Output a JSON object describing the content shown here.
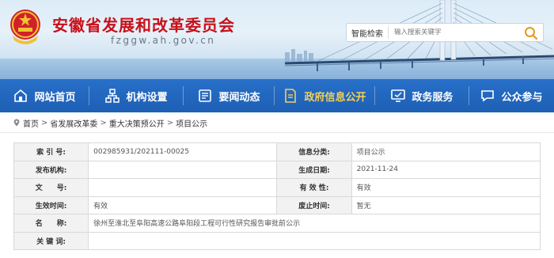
{
  "header": {
    "site_title": "安徽省发展和改革委员会",
    "site_url": "fzggw.ah.gov.cn"
  },
  "search": {
    "scope": "智能检索",
    "placeholder": "输入搜索关键字"
  },
  "nav": {
    "items": [
      {
        "label": "网站首页",
        "icon": "home-icon"
      },
      {
        "label": "机构设置",
        "icon": "org-icon"
      },
      {
        "label": "要闻动态",
        "icon": "news-icon"
      },
      {
        "label": "政府信息公开",
        "icon": "document-icon",
        "active": true
      },
      {
        "label": "政务服务",
        "icon": "monitor-icon"
      },
      {
        "label": "公众参与",
        "icon": "chat-icon"
      }
    ],
    "active_color": "#f1d05a",
    "bar_color": "#1d5fb5"
  },
  "breadcrumb": [
    "首页",
    "省发展改革委",
    "重大决策预公开",
    "项目公示"
  ],
  "info": {
    "index_label": "索 引 号:",
    "index_value": "002985931/202111-00025",
    "category_label": "信息分类:",
    "category_value": "项目公示",
    "publisher_label": "发布机构:",
    "publisher_value": "",
    "date_label": "生成日期:",
    "date_value": "2021-11-24",
    "docno_label": "文　　号:",
    "docno_value": "",
    "validity_label": "有 效 性:",
    "validity_value": "有效",
    "effective_label": "生效时间:",
    "effective_value": "有效",
    "expiry_label": "废止时间:",
    "expiry_value": "暂无",
    "name_label": "名　　称:",
    "name_value": "徐州至淮北至阜阳高速公路阜阳段工程可行性研究报告审批前公示",
    "keywords_label": "关 键 词:",
    "keywords_value": ""
  }
}
